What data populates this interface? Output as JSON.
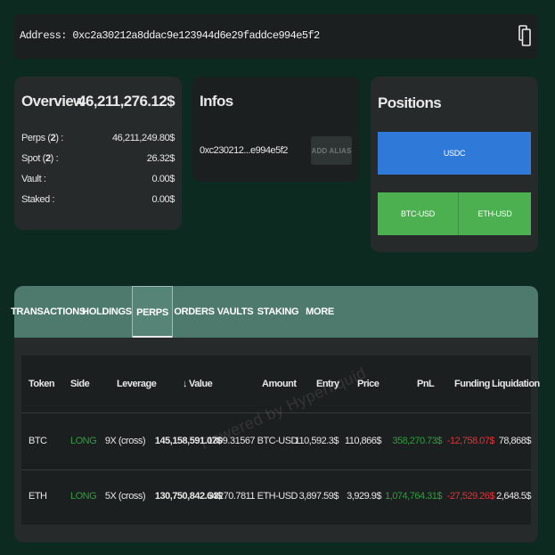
{
  "address": {
    "text": "Address: 0xc2a30212a8ddac9e123944d6e29faddce994e5f2"
  },
  "overview": {
    "title": "Overview",
    "total": "46,211,276.12$",
    "rows": [
      {
        "label_pre": "Perps (",
        "count": "2",
        "label_post": ") :",
        "value": "46,211,249.80$"
      },
      {
        "label_pre": "Spot (",
        "count": "2",
        "label_post": ") :",
        "value": "26.32$"
      },
      {
        "label": "Vault :",
        "value": "0.00$"
      },
      {
        "label": "Staked :",
        "value": "0.00$"
      }
    ]
  },
  "infos": {
    "title": "Infos",
    "short_address": "0xc230212...e994e5f2",
    "alias_button": "ADD ALIAS"
  },
  "positions": {
    "title": "Positions",
    "usdc": "USDC",
    "btc": "BTC-USD",
    "eth": "ETH-USD"
  },
  "tabs": [
    "TRANSACTIONS",
    "HOLDINGS",
    "PERPS",
    "ORDERS",
    "VAULTS",
    "STAKING",
    "MORE"
  ],
  "active_tab": "PERPS",
  "table": {
    "headers": [
      "Token",
      "Side",
      "Leverage",
      "Value",
      "Amount",
      "Entry",
      "Price",
      "PnL",
      "Funding",
      "Liquidation"
    ],
    "sort_indicator": "↓",
    "rows": [
      {
        "token": "BTC",
        "side": "LONG",
        "leverage": "9X (cross)",
        "value": "145,158,591.07$",
        "amount": "1309.31567 BTC-USD",
        "entry": "110,592.3$",
        "price": "110,866$",
        "pnl": "358,270.73$",
        "funding": "-12,758.07$",
        "liquidation": "78,868$"
      },
      {
        "token": "ETH",
        "side": "LONG",
        "leverage": "5X (cross)",
        "value": "130,750,842.64$",
        "amount": "33270.7811 ETH-USD",
        "entry": "3,897.59$",
        "price": "3,929.9$",
        "pnl": "1,074,764.31$",
        "funding": "-27,529.26$",
        "liquidation": "2,648.5$"
      }
    ]
  },
  "watermark": "Powered by Hyperliquid",
  "colors": {
    "background": "#0d2a20",
    "card": "#262a2a",
    "tab_bar": "#4e7a6e",
    "usdc_button": "#2f79d8",
    "position_button": "#4caf50",
    "long": "#2e9e3c",
    "negative": "#e0323a"
  }
}
